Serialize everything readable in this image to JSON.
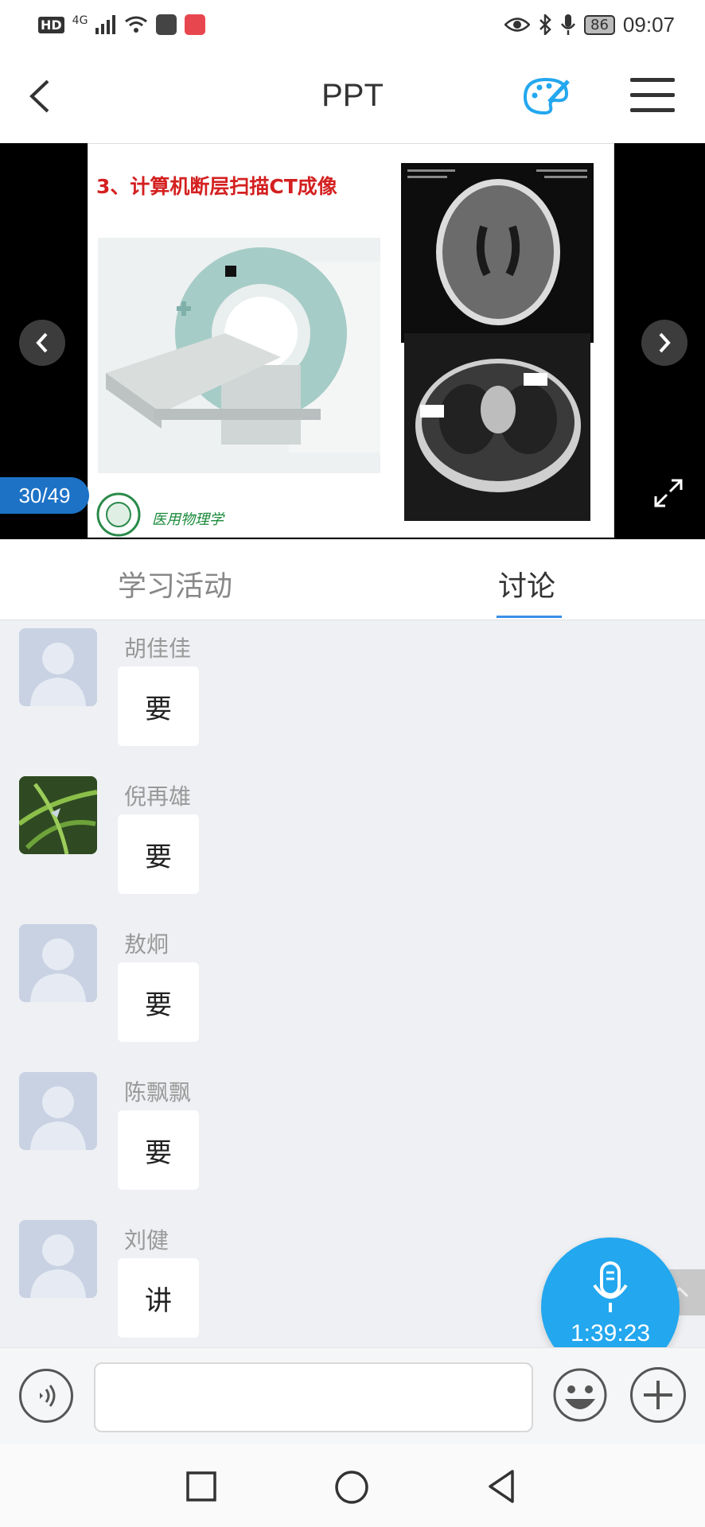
{
  "status_bar": {
    "hd": "HD",
    "network": "4G",
    "battery": "86",
    "time": "09:07"
  },
  "nav": {
    "title": "PPT"
  },
  "slide": {
    "title": "3、计算机断层扫描CT成像",
    "logo_text": "医用物理学",
    "page_indicator": "30/49"
  },
  "tabs": [
    {
      "label": "学习活动",
      "active": false
    },
    {
      "label": "讨论",
      "active": true
    }
  ],
  "messages": [
    {
      "sender": "胡佳佳",
      "text": "要",
      "avatar": "default-avatar"
    },
    {
      "sender": "倪再雄",
      "text": "要",
      "avatar": "photo-avatar"
    },
    {
      "sender": "敖炯",
      "text": "要",
      "avatar": "default-avatar"
    },
    {
      "sender": "陈飘飘",
      "text": "要",
      "avatar": "default-avatar"
    },
    {
      "sender": "刘健",
      "text": "讲",
      "avatar": "default-avatar"
    }
  ],
  "voice_fab": {
    "timer": "1:39:23"
  },
  "input": {
    "placeholder": ""
  },
  "colors": {
    "accent_blue": "#23a7ef",
    "page_indicator_blue": "#1d72c6",
    "tab_underline": "#3a8ee6",
    "slide_title_red": "#d42020",
    "chat_bg": "#eef0f3"
  }
}
